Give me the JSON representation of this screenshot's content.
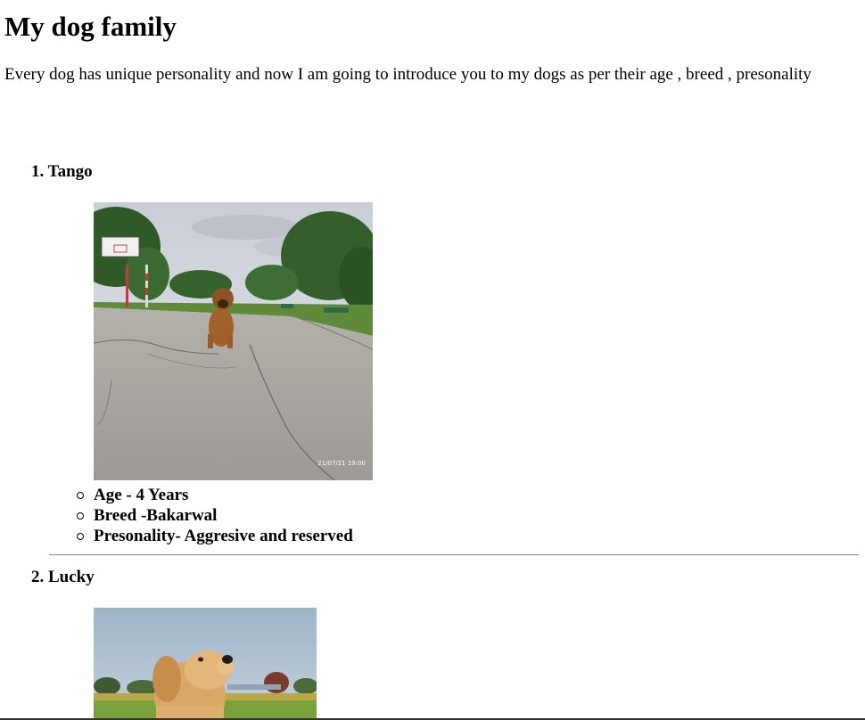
{
  "page": {
    "title": "My dog family",
    "intro": "Every dog has unique personality and now I am going to introduce you to my dogs as per their age , breed , presonality"
  },
  "dogs": [
    {
      "heading": "1. Tango",
      "photo_alt": "Tango",
      "facts": [
        "Age - 4 Years",
        "Breed -Bakarwal",
        "Presonality- Aggresive and reserved"
      ],
      "photo_stamp": "21/07/21 19:00"
    },
    {
      "heading": "2. Lucky",
      "photo_alt": "Lucky"
    }
  ],
  "icons": {
    "list_bullet": "hollow-circle-icon"
  }
}
